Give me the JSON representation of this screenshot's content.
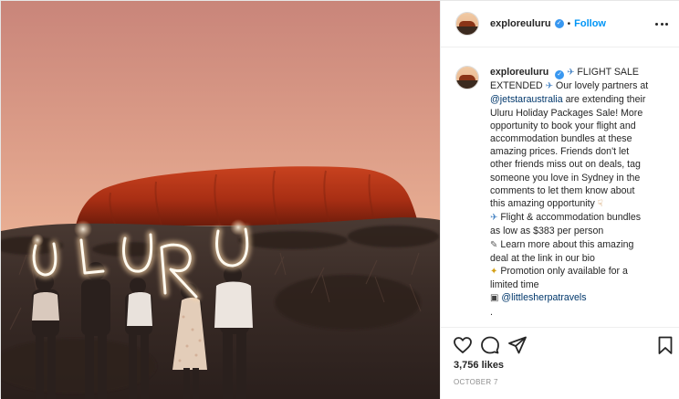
{
  "post": {
    "username": "exploreuluru",
    "follow_label": "Follow",
    "header_separator": "•",
    "verified_glyph": "✓"
  },
  "caption": {
    "username": "exploreuluru",
    "lines": [
      {
        "emoji": "✈",
        "text": " FLIGHT SALE"
      },
      {
        "text": "EXTENDED ",
        "emoji_after": "✈",
        "tail": " Our lovely partners at"
      },
      {
        "mention": "@jetstaraustralia",
        "tail": " are extending their"
      },
      {
        "text": "Uluru Holiday Packages Sale! More"
      },
      {
        "text": "opportunity to book your flight and"
      },
      {
        "text": "accommodation bundles at these"
      },
      {
        "text": "amazing prices. Friends don't let"
      },
      {
        "text": "other friends miss out on deals, tag"
      },
      {
        "text": "someone you love in Sydney in the"
      },
      {
        "text": "comments to let them know about"
      },
      {
        "text": "this amazing opportunity ",
        "emoji_after": "☟"
      },
      {
        "emoji": "✈",
        "text": " Flight & accommodation bundles"
      },
      {
        "text": "as low as $383 per person"
      },
      {
        "emoji": "✎",
        "text": " Learn more about this amazing"
      },
      {
        "text": "deal at the link in our bio"
      },
      {
        "emoji": "✦",
        "text": " Promotion only available for a"
      },
      {
        "text": "limited time"
      },
      {
        "emoji": "▣",
        "mention": " @littlesherpatravels"
      },
      {
        "text": "."
      },
      {
        "text": "."
      }
    ]
  },
  "stats": {
    "likes": "3,756 likes",
    "date": "OCTOBER 7"
  },
  "photo": {
    "light_text": "ULURU"
  },
  "icons": {
    "like": "heart-icon",
    "comment": "comment-icon",
    "share": "share-icon",
    "save": "bookmark-icon",
    "options": "more-options-icon",
    "verified": "verified-badge-icon"
  },
  "colors": {
    "accent": "#0095f6",
    "verified": "#3897f0",
    "mention": "#00376b",
    "muted": "#8e8e8e"
  }
}
